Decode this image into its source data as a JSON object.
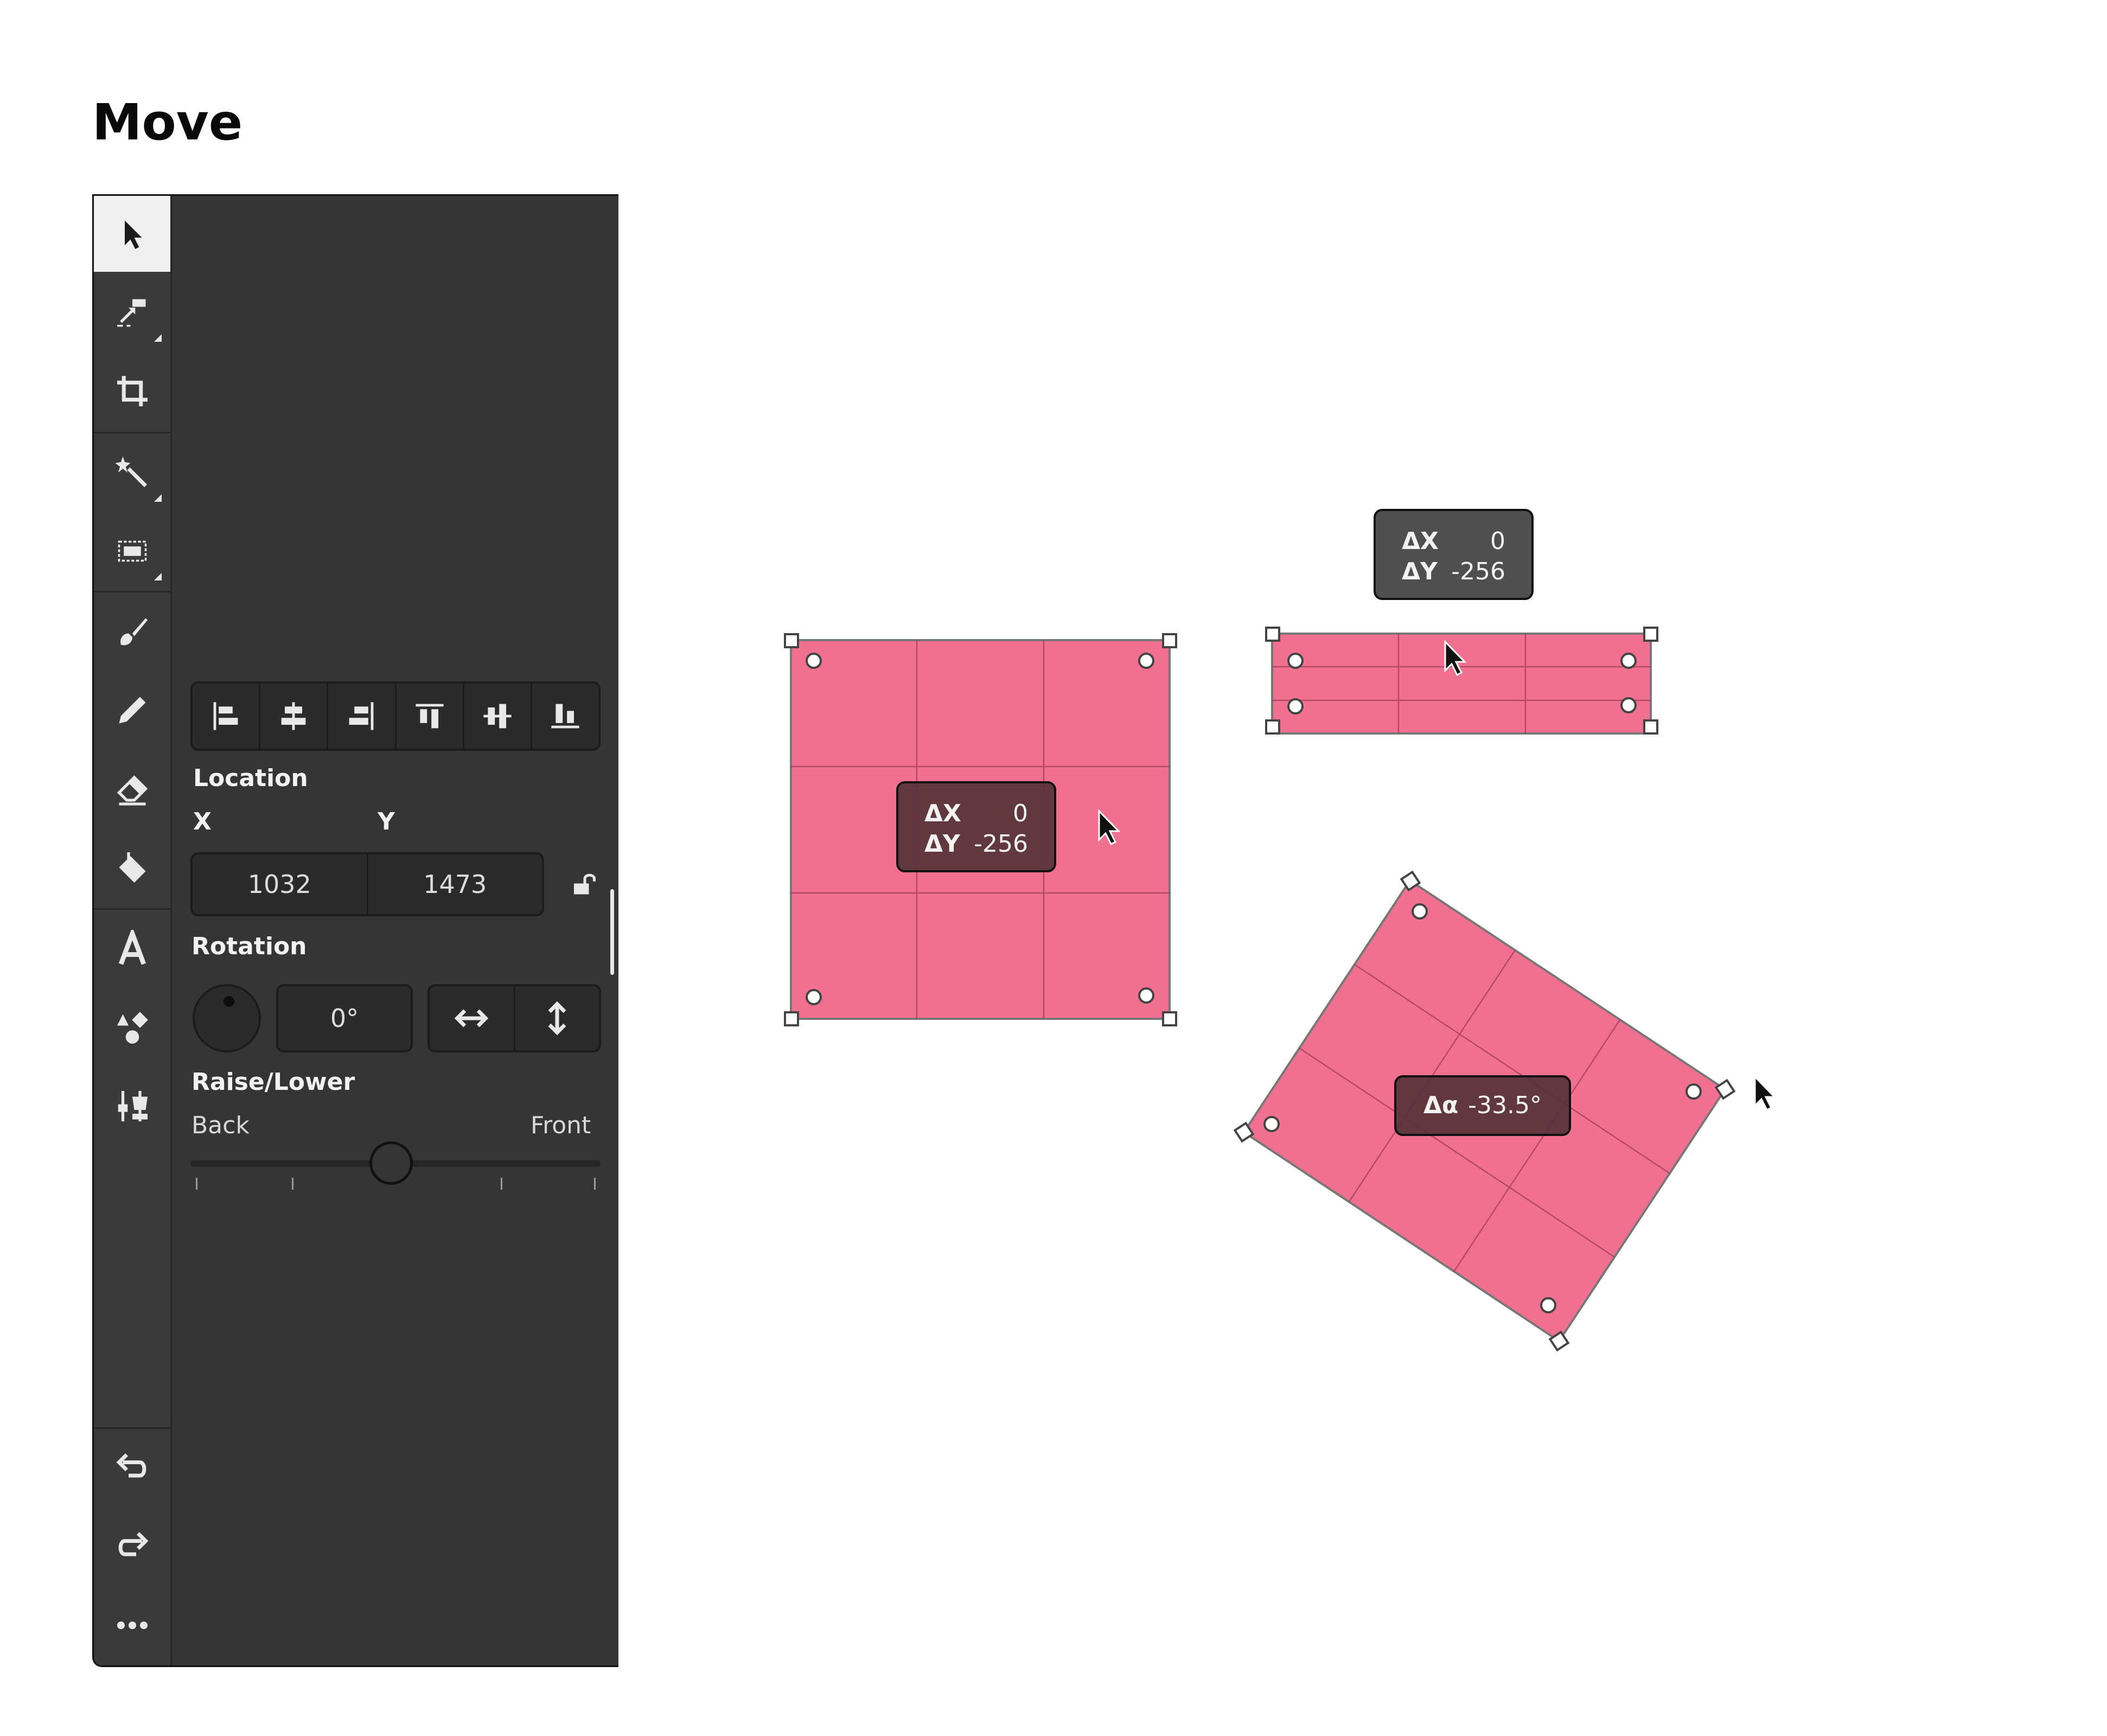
{
  "page": {
    "title": "Move"
  },
  "toolbar": {
    "tools": [
      {
        "name": "select-tool",
        "active": true
      },
      {
        "name": "move-tool",
        "submenu": true
      },
      {
        "name": "crop-tool"
      },
      {
        "name": "magic-wand-tool",
        "submenu": true
      },
      {
        "name": "rectangle-select-tool",
        "submenu": true
      },
      {
        "name": "brush-tool"
      },
      {
        "name": "pencil-tool"
      },
      {
        "name": "eraser-tool"
      },
      {
        "name": "fill-tool"
      },
      {
        "name": "text-tool"
      },
      {
        "name": "shapes-tool"
      },
      {
        "name": "adjustments-tool"
      },
      {
        "name": "undo"
      },
      {
        "name": "redo"
      },
      {
        "name": "more"
      }
    ]
  },
  "properties": {
    "location_label": "Location",
    "x_label": "X",
    "y_label": "Y",
    "x_value": "1032",
    "y_value": "1473",
    "rotation_label": "Rotation",
    "rotation_value": "0°",
    "raise_lower_label": "Raise/Lower",
    "back_label": "Back",
    "front_label": "Front",
    "raise_lower_level": 0.49
  },
  "canvas": {
    "tooltip_square": {
      "dx_label": "ΔX",
      "dx_value": "0",
      "dy_label": "ΔY",
      "dy_value": "-256"
    },
    "tooltip_top": {
      "dx_label": "ΔX",
      "dx_value": "0",
      "dy_label": "ΔY",
      "dy_value": "-256"
    },
    "tooltip_rotated": {
      "angle_label": "Δα",
      "angle_value": "-33.5°"
    },
    "shape_color": "#f2708f"
  }
}
